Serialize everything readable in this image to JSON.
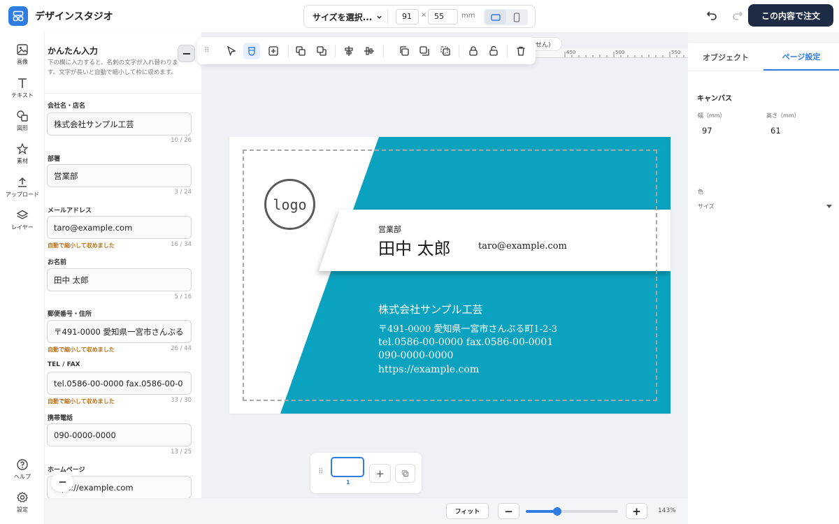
{
  "app": {
    "name": "デザインスタジオ",
    "order_label": "この内容で注文"
  },
  "size_bar": {
    "select_label": "サイズを選択...",
    "width": "91",
    "height": "55",
    "x_sep": "×",
    "unit": "mm",
    "orientation": "landscape"
  },
  "rail": {
    "items": [
      {
        "label": "画像",
        "icon": "image-icon"
      },
      {
        "label": "テキスト",
        "icon": "text-icon"
      },
      {
        "label": "図形",
        "icon": "shapes-icon"
      },
      {
        "label": "素材",
        "icon": "star-icon"
      },
      {
        "label": "アップロード",
        "icon": "upload-icon"
      },
      {
        "label": "レイヤー",
        "icon": "layers-icon"
      }
    ],
    "bottom": [
      {
        "label": "ヘルプ",
        "icon": "help-icon"
      },
      {
        "label": "設定",
        "icon": "gear-icon"
      }
    ]
  },
  "input_panel": {
    "title": "かんたん入力",
    "description": "下の欄に入力すると、名刺の文字が入れ替わります。文字が長いと自動で縮小して枠に収めます。",
    "fields": [
      {
        "label": "会社名・店名",
        "value": "株式会社サンプル工芸",
        "count": "10 / 26",
        "warning": ""
      },
      {
        "label": "部署",
        "value": "営業部",
        "count": "3 / 24",
        "warning": ""
      },
      {
        "label": "メールアドレス",
        "value": "taro@example.com",
        "count": "16 / 34",
        "warning": "自動で縮小して収めました"
      },
      {
        "label": "お名前",
        "value": "田中 太郎",
        "count": "5 / 16",
        "warning": ""
      },
      {
        "label": "郵便番号・住所",
        "value": "〒491-0000 愛知県一宮市さんぶる",
        "count": "26 / 44",
        "warning": "自動で縮小して収めました"
      },
      {
        "label": "TEL / FAX",
        "value": "tel.0586-00-0000 fax.0586-00-0",
        "count": "33 / 30",
        "warning": "自動で縮小して収めました"
      },
      {
        "label": "携帯電話",
        "value": "090-0000-0000",
        "count": "13 / 25",
        "warning": ""
      },
      {
        "label": "ホームページ",
        "value": "ps://example.com",
        "count": "",
        "warning": ""
      }
    ]
  },
  "ruler": {
    "labels": [
      "450",
      "500",
      "550"
    ]
  },
  "toolbar_hint_tail": "せん)",
  "card": {
    "logo_text": "logo",
    "department": "営業部",
    "name": "田中 太郎",
    "email": "taro@example.com",
    "company": "株式会社サンプル工芸",
    "address": "〒491-0000 愛知県一宮市さんぶる町1-2-3",
    "tel_fax": "tel.0586-00-0000 fax.0586-00-0001",
    "mobile": "090-0000-0000",
    "url": "https://example.com",
    "colors": {
      "accent": "#0aa2bf",
      "band": "#ffffff",
      "text_dark": "#1a1a1a"
    }
  },
  "pages": {
    "current": "1",
    "add_label": "+"
  },
  "zoom": {
    "fit_label": "フィット",
    "minus": "−",
    "plus": "+",
    "value": "143%",
    "level": 0.34
  },
  "right_panel": {
    "tabs": [
      "オブジェクト",
      "ページ設定"
    ],
    "active_tab": 1,
    "section": "キャンバス",
    "width_label": "幅（mm）",
    "width_value": "97",
    "height_label": "高さ（mm）",
    "height_value": "61",
    "color_label": "色",
    "size_label": "サイズ"
  },
  "colors": {
    "primary": "#2f7de1",
    "order_button": "#1d2b45",
    "warning": "#b8701a"
  }
}
